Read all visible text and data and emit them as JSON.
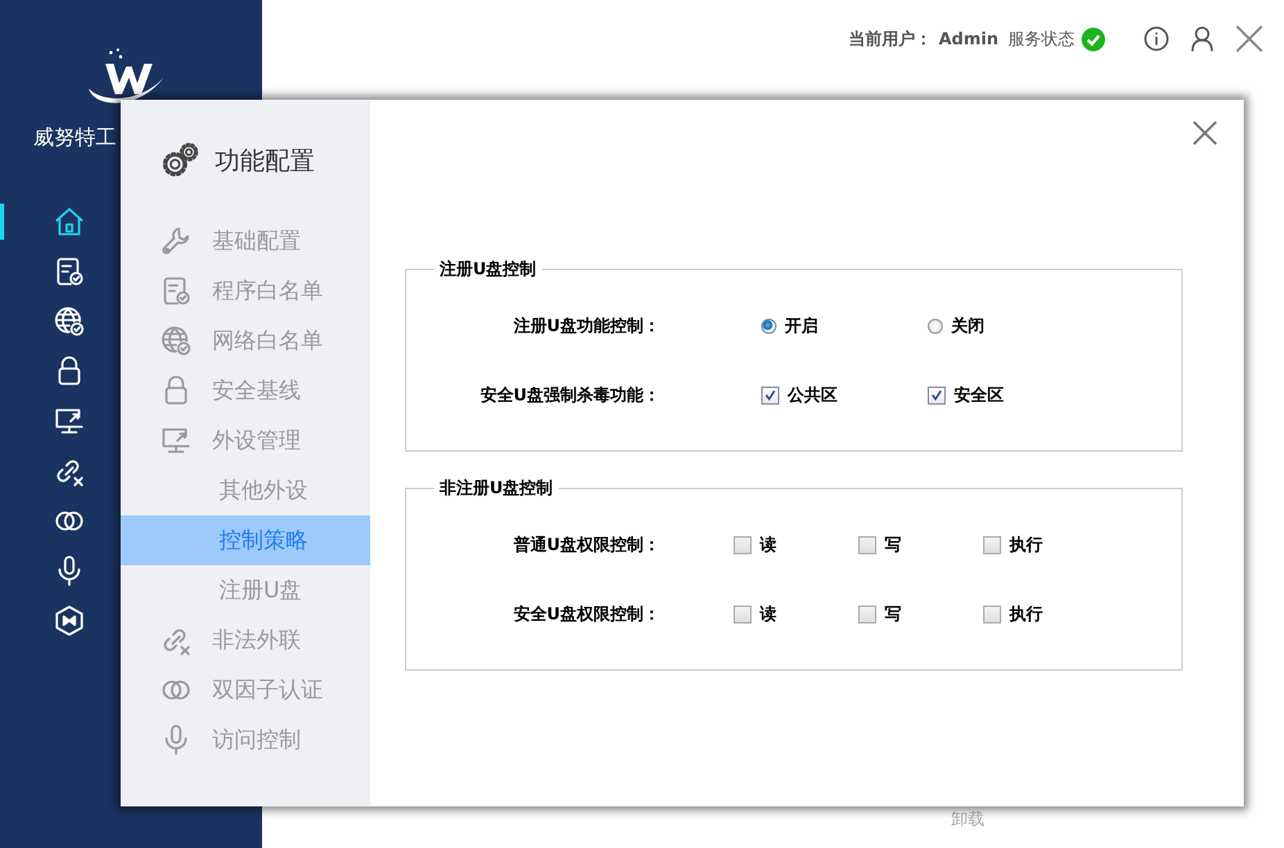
{
  "sidebar": {
    "brand": "威努特工",
    "nav": [
      {
        "selected": true
      },
      {
        "selected": false
      },
      {
        "selected": false
      },
      {
        "selected": false
      },
      {
        "selected": false
      },
      {
        "selected": false
      },
      {
        "selected": false
      },
      {
        "selected": false
      },
      {
        "selected": false
      }
    ]
  },
  "top_bar": {
    "user_label": "当前用户：",
    "user": "Admin",
    "service_label": "服务状态",
    "service_ok": true
  },
  "footer": {
    "text": "卸载"
  },
  "dialog": {
    "title": "功能配置",
    "menu": [
      {
        "label": "基础配置",
        "kind": "item",
        "selected": false
      },
      {
        "label": "程序白名单",
        "kind": "item",
        "selected": false
      },
      {
        "label": "网络白名单",
        "kind": "item",
        "selected": false
      },
      {
        "label": "安全基线",
        "kind": "item",
        "selected": false
      },
      {
        "label": "外设管理",
        "kind": "item",
        "selected": false
      },
      {
        "label": "其他外设",
        "kind": "sub",
        "selected": false
      },
      {
        "label": "控制策略",
        "kind": "sub",
        "selected": true
      },
      {
        "label": "注册U盘",
        "kind": "sub",
        "selected": false
      },
      {
        "label": "非法外联",
        "kind": "item",
        "selected": false
      },
      {
        "label": "双因子认证",
        "kind": "item",
        "selected": false
      },
      {
        "label": "访问控制",
        "kind": "item",
        "selected": false
      }
    ],
    "sections": [
      {
        "title": "注册U盘控制",
        "rows": [
          {
            "label": "注册U盘功能控制：",
            "kind": "radio",
            "options": [
              {
                "label": "开启",
                "selected": true
              },
              {
                "label": "关闭",
                "selected": false
              }
            ]
          },
          {
            "label": "安全U盘强制杀毒功能：",
            "kind": "checkbox",
            "options": [
              {
                "label": "公共区",
                "checked": true
              },
              {
                "label": "安全区",
                "checked": true
              }
            ]
          }
        ]
      },
      {
        "title": "非注册U盘控制",
        "rows": [
          {
            "label": "普通U盘权限控制：",
            "kind": "checkbox",
            "options": [
              {
                "label": "读",
                "checked": false
              },
              {
                "label": "写",
                "checked": false
              },
              {
                "label": "执行",
                "checked": false
              }
            ]
          },
          {
            "label": "安全U盘权限控制：",
            "kind": "checkbox",
            "options": [
              {
                "label": "读",
                "checked": false
              },
              {
                "label": "写",
                "checked": false
              },
              {
                "label": "执行",
                "checked": false
              }
            ]
          }
        ]
      }
    ]
  }
}
